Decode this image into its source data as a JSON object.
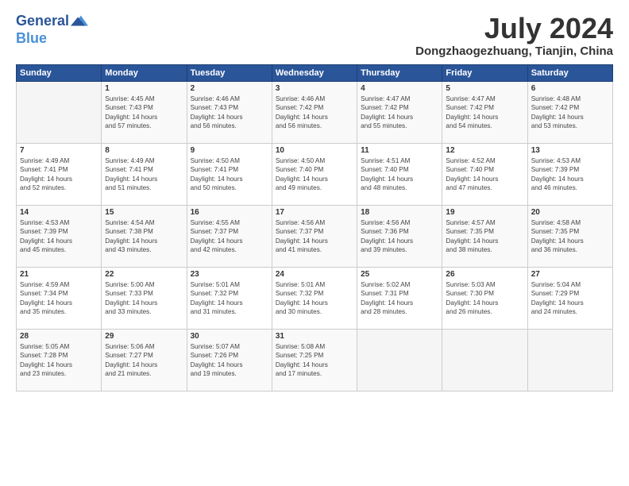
{
  "logo": {
    "line1": "General",
    "line2": "Blue"
  },
  "title": "July 2024",
  "location": "Dongzhaogezhuang, Tianjin, China",
  "days_of_week": [
    "Sunday",
    "Monday",
    "Tuesday",
    "Wednesday",
    "Thursday",
    "Friday",
    "Saturday"
  ],
  "weeks": [
    [
      {
        "day": "",
        "content": ""
      },
      {
        "day": "1",
        "content": "Sunrise: 4:45 AM\nSunset: 7:43 PM\nDaylight: 14 hours\nand 57 minutes."
      },
      {
        "day": "2",
        "content": "Sunrise: 4:46 AM\nSunset: 7:43 PM\nDaylight: 14 hours\nand 56 minutes."
      },
      {
        "day": "3",
        "content": "Sunrise: 4:46 AM\nSunset: 7:42 PM\nDaylight: 14 hours\nand 56 minutes."
      },
      {
        "day": "4",
        "content": "Sunrise: 4:47 AM\nSunset: 7:42 PM\nDaylight: 14 hours\nand 55 minutes."
      },
      {
        "day": "5",
        "content": "Sunrise: 4:47 AM\nSunset: 7:42 PM\nDaylight: 14 hours\nand 54 minutes."
      },
      {
        "day": "6",
        "content": "Sunrise: 4:48 AM\nSunset: 7:42 PM\nDaylight: 14 hours\nand 53 minutes."
      }
    ],
    [
      {
        "day": "7",
        "content": "Sunrise: 4:49 AM\nSunset: 7:41 PM\nDaylight: 14 hours\nand 52 minutes."
      },
      {
        "day": "8",
        "content": "Sunrise: 4:49 AM\nSunset: 7:41 PM\nDaylight: 14 hours\nand 51 minutes."
      },
      {
        "day": "9",
        "content": "Sunrise: 4:50 AM\nSunset: 7:41 PM\nDaylight: 14 hours\nand 50 minutes."
      },
      {
        "day": "10",
        "content": "Sunrise: 4:50 AM\nSunset: 7:40 PM\nDaylight: 14 hours\nand 49 minutes."
      },
      {
        "day": "11",
        "content": "Sunrise: 4:51 AM\nSunset: 7:40 PM\nDaylight: 14 hours\nand 48 minutes."
      },
      {
        "day": "12",
        "content": "Sunrise: 4:52 AM\nSunset: 7:40 PM\nDaylight: 14 hours\nand 47 minutes."
      },
      {
        "day": "13",
        "content": "Sunrise: 4:53 AM\nSunset: 7:39 PM\nDaylight: 14 hours\nand 46 minutes."
      }
    ],
    [
      {
        "day": "14",
        "content": "Sunrise: 4:53 AM\nSunset: 7:39 PM\nDaylight: 14 hours\nand 45 minutes."
      },
      {
        "day": "15",
        "content": "Sunrise: 4:54 AM\nSunset: 7:38 PM\nDaylight: 14 hours\nand 43 minutes."
      },
      {
        "day": "16",
        "content": "Sunrise: 4:55 AM\nSunset: 7:37 PM\nDaylight: 14 hours\nand 42 minutes."
      },
      {
        "day": "17",
        "content": "Sunrise: 4:56 AM\nSunset: 7:37 PM\nDaylight: 14 hours\nand 41 minutes."
      },
      {
        "day": "18",
        "content": "Sunrise: 4:56 AM\nSunset: 7:36 PM\nDaylight: 14 hours\nand 39 minutes."
      },
      {
        "day": "19",
        "content": "Sunrise: 4:57 AM\nSunset: 7:35 PM\nDaylight: 14 hours\nand 38 minutes."
      },
      {
        "day": "20",
        "content": "Sunrise: 4:58 AM\nSunset: 7:35 PM\nDaylight: 14 hours\nand 36 minutes."
      }
    ],
    [
      {
        "day": "21",
        "content": "Sunrise: 4:59 AM\nSunset: 7:34 PM\nDaylight: 14 hours\nand 35 minutes."
      },
      {
        "day": "22",
        "content": "Sunrise: 5:00 AM\nSunset: 7:33 PM\nDaylight: 14 hours\nand 33 minutes."
      },
      {
        "day": "23",
        "content": "Sunrise: 5:01 AM\nSunset: 7:32 PM\nDaylight: 14 hours\nand 31 minutes."
      },
      {
        "day": "24",
        "content": "Sunrise: 5:01 AM\nSunset: 7:32 PM\nDaylight: 14 hours\nand 30 minutes."
      },
      {
        "day": "25",
        "content": "Sunrise: 5:02 AM\nSunset: 7:31 PM\nDaylight: 14 hours\nand 28 minutes."
      },
      {
        "day": "26",
        "content": "Sunrise: 5:03 AM\nSunset: 7:30 PM\nDaylight: 14 hours\nand 26 minutes."
      },
      {
        "day": "27",
        "content": "Sunrise: 5:04 AM\nSunset: 7:29 PM\nDaylight: 14 hours\nand 24 minutes."
      }
    ],
    [
      {
        "day": "28",
        "content": "Sunrise: 5:05 AM\nSunset: 7:28 PM\nDaylight: 14 hours\nand 23 minutes."
      },
      {
        "day": "29",
        "content": "Sunrise: 5:06 AM\nSunset: 7:27 PM\nDaylight: 14 hours\nand 21 minutes."
      },
      {
        "day": "30",
        "content": "Sunrise: 5:07 AM\nSunset: 7:26 PM\nDaylight: 14 hours\nand 19 minutes."
      },
      {
        "day": "31",
        "content": "Sunrise: 5:08 AM\nSunset: 7:25 PM\nDaylight: 14 hours\nand 17 minutes."
      },
      {
        "day": "",
        "content": ""
      },
      {
        "day": "",
        "content": ""
      },
      {
        "day": "",
        "content": ""
      }
    ]
  ]
}
